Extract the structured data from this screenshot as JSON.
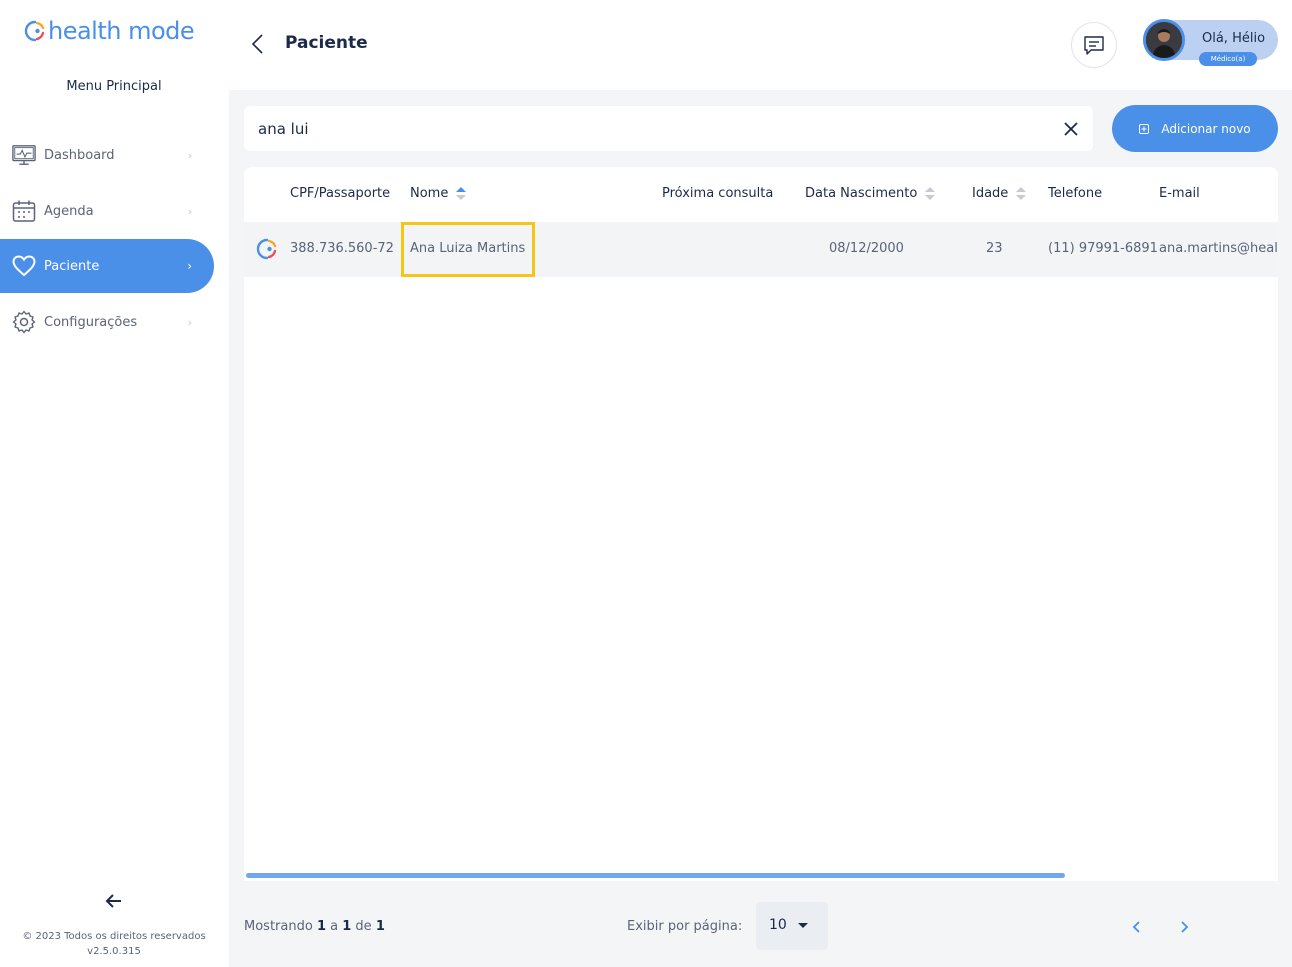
{
  "brand": {
    "name": "health mode",
    "color": "#4a8fe8"
  },
  "sidebar": {
    "menu_title": "Menu Principal",
    "items": [
      {
        "label": "Dashboard",
        "icon": "monitor-icon",
        "active": false
      },
      {
        "label": "Agenda",
        "icon": "calendar-icon",
        "active": false
      },
      {
        "label": "Paciente",
        "icon": "heart-icon",
        "active": true
      },
      {
        "label": "Configurações",
        "icon": "gear-icon",
        "active": false
      }
    ],
    "footer_copyright": "© 2023 Todos os direitos reservados",
    "footer_version": "v2.5.0.315"
  },
  "header": {
    "title": "Paciente",
    "user_greeting": "Olá, Hélio",
    "user_role": "Médico(a)"
  },
  "search": {
    "value": "ana lui"
  },
  "actions": {
    "add_label": "Adicionar novo"
  },
  "table": {
    "columns": {
      "cpf": "CPF/Passaporte",
      "nome": "Nome",
      "proxima": "Próxima consulta",
      "nascimento": "Data Nascimento",
      "idade": "Idade",
      "telefone": "Telefone",
      "email": "E-mail"
    },
    "rows": [
      {
        "cpf": "388.736.560-72",
        "nome": "Ana Luiza Martins",
        "proxima": "",
        "nascimento": "08/12/2000",
        "idade": "23",
        "telefone": "(11) 97991-6891",
        "email": "ana.martins@healt"
      }
    ]
  },
  "pagination": {
    "showing_prefix": "Mostrando",
    "from": "1",
    "sep_a": "a",
    "to": "1",
    "sep_de": "de",
    "total": "1",
    "per_page_label": "Exibir por página:",
    "per_page_value": "10"
  },
  "colors": {
    "accent": "#4a8fe8",
    "highlight": "#f5c518",
    "text_dark": "#1c2a4a",
    "text_muted": "#5a6478"
  }
}
